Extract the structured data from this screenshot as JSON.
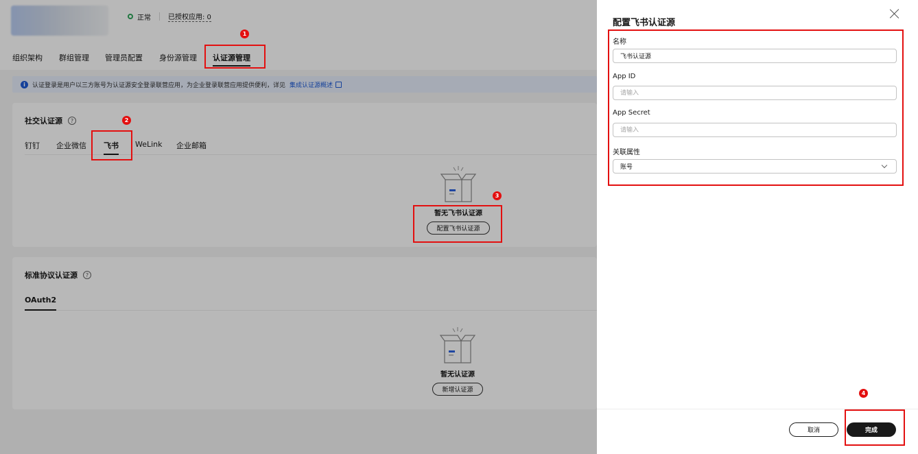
{
  "header": {
    "status_label": "正常",
    "authorized_apps": "已授权应用: 0"
  },
  "main_tabs": [
    {
      "label": "组织架构"
    },
    {
      "label": "群组管理"
    },
    {
      "label": "管理员配置"
    },
    {
      "label": "身份源管理"
    },
    {
      "label": "认证源管理",
      "active": true
    }
  ],
  "info_bar": {
    "text": "认证登录是用户以三方账号为认证源安全登录联营应用，为企业登录联营应用提供便利，详见",
    "link": "集成认证源概述"
  },
  "social_card": {
    "title": "社交认证源",
    "tabs": [
      {
        "label": "钉钉"
      },
      {
        "label": "企业微信"
      },
      {
        "label": "飞书",
        "active": true
      },
      {
        "label": "WeLink"
      },
      {
        "label": "企业邮箱"
      }
    ],
    "empty_title": "暂无飞书认证源",
    "empty_button": "配置飞书认证源"
  },
  "protocol_card": {
    "title": "标准协议认证源",
    "tabs": [
      {
        "label": "OAuth2",
        "active": true
      }
    ],
    "empty_title": "暂无认证源",
    "empty_button": "新增认证源"
  },
  "drawer": {
    "title": "配置飞书认证源",
    "fields": {
      "name": {
        "label": "名称",
        "value": "飞书认证源"
      },
      "app_id": {
        "label": "App ID",
        "placeholder": "请输入"
      },
      "app_secret": {
        "label": "App Secret",
        "placeholder": "请输入"
      },
      "attribute": {
        "label": "关联属性",
        "value": "账号"
      }
    },
    "cancel_label": "取消",
    "ok_label": "完成"
  },
  "markers": [
    "1",
    "2",
    "3",
    "4"
  ],
  "colors": {
    "highlight": "#e30f0f",
    "primary_button": "#191919",
    "link": "#1e5bd6",
    "status_ok": "#2fa65b",
    "info_bg": "#e6edfb"
  }
}
